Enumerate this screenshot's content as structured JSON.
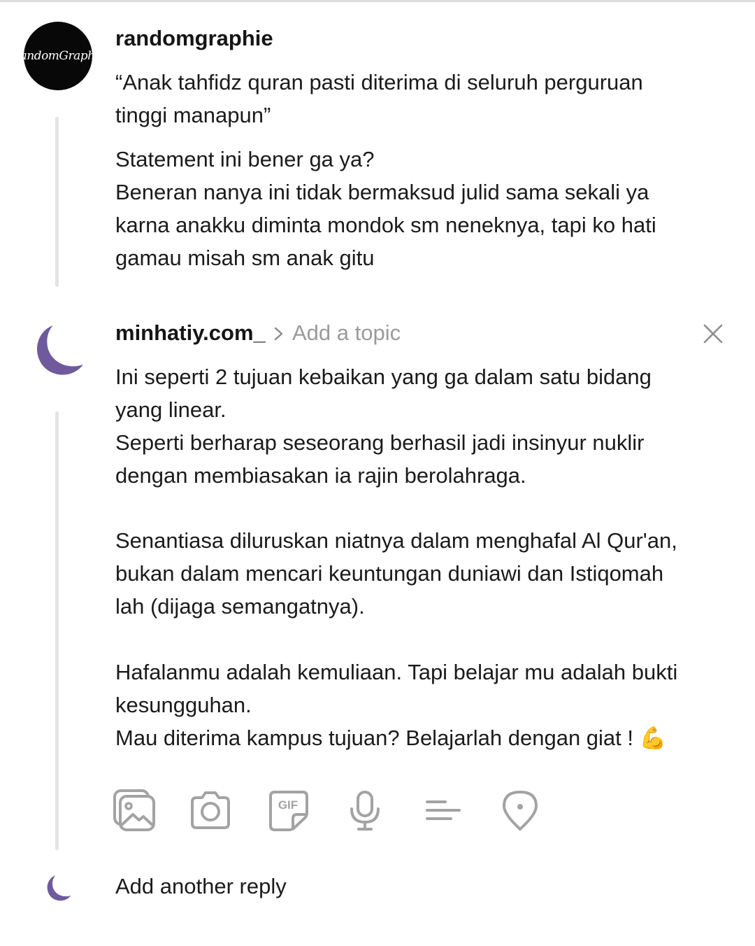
{
  "thread": {
    "original_post": {
      "username": "randomgraphie",
      "avatar_text": "RandomGraphie",
      "paragraph_1": "“Anak tahfidz quran pasti diterima di seluruh perguruan\ntinggi manapun”",
      "paragraph_2": "Statement ini bener ga ya?\nBeneran nanya ini tidak bermaksud julid sama sekali ya\nkarna anakku diminta mondok sm neneknya, tapi ko hati\ngamau misah sm anak gitu"
    },
    "reply_draft": {
      "username": "minhatiy.com_",
      "topic_placeholder": "Add a topic",
      "paragraph_1": "Ini seperti 2 tujuan kebaikan yang ga dalam satu bidang\nyang linear.\nSeperti berharap seseorang berhasil jadi insinyur nuklir\ndengan membiasakan ia rajin berolahraga.",
      "paragraph_2": "Senantiasa diluruskan niatnya dalam menghafal Al Qur'an,\nbukan dalam mencari keuntungan duniawi dan Istiqomah\nlah (dijaga semangatnya).",
      "paragraph_3_lines": "Hafalanmu adalah kemuliaan. Tapi belajar mu adalah bukti\nkesungguhan.\nMau diterima kampus tujuan? Belajarlah dengan giat ! ",
      "emoji": "💪",
      "gif_label": "GIF"
    },
    "add_reply_placeholder": "Add another reply"
  },
  "colors": {
    "moon_avatar": "#6e5a9c",
    "icon_gray": "#a3a3a3",
    "divider": "#e3e3e3"
  },
  "icons": [
    "image-icon",
    "camera-icon",
    "gif-icon",
    "microphone-icon",
    "align-left-icon",
    "location-pin-icon",
    "close-icon",
    "chevron-right-icon"
  ]
}
